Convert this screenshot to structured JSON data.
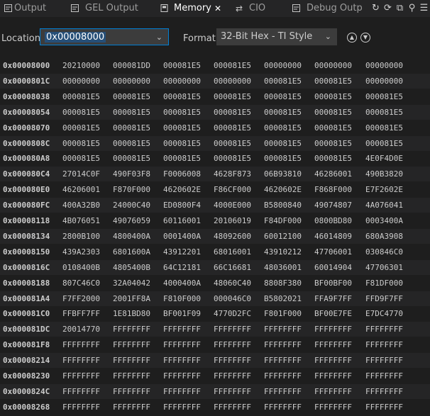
{
  "tabs": [
    {
      "label": "Output",
      "icon": "output-icon",
      "active": false
    },
    {
      "label": "GEL Output",
      "icon": "gel-output-icon",
      "active": false
    },
    {
      "label": "Memory",
      "icon": "memory-icon",
      "active": true
    },
    {
      "label": "CIO",
      "icon": "cio-icon",
      "active": false
    },
    {
      "label": "Debug Outp",
      "icon": "debug-output-icon",
      "active": false
    }
  ],
  "actions": [
    "refresh-icon",
    "sync-icon",
    "copy-icon",
    "pin-icon",
    "menu-icon"
  ],
  "toolbar": {
    "location_label": "Location",
    "location_value": "0x00008000",
    "format_label": "Format",
    "format_value": "32-Bit Hex - TI Style"
  },
  "memory": {
    "rows": [
      [
        "0x00008000",
        "20210000",
        "000081DD",
        "000081E5",
        "000081E5",
        "00000000",
        "00000000",
        "00000000"
      ],
      [
        "0x0000801C",
        "00000000",
        "00000000",
        "00000000",
        "00000000",
        "000081E5",
        "000081E5",
        "00000000"
      ],
      [
        "0x00008038",
        "000081E5",
        "000081E5",
        "000081E5",
        "000081E5",
        "000081E5",
        "000081E5",
        "000081E5"
      ],
      [
        "0x00008054",
        "000081E5",
        "000081E5",
        "000081E5",
        "000081E5",
        "000081E5",
        "000081E5",
        "000081E5"
      ],
      [
        "0x00008070",
        "000081E5",
        "000081E5",
        "000081E5",
        "000081E5",
        "000081E5",
        "000081E5",
        "000081E5"
      ],
      [
        "0x0000808C",
        "000081E5",
        "000081E5",
        "000081E5",
        "000081E5",
        "000081E5",
        "000081E5",
        "000081E5"
      ],
      [
        "0x000080A8",
        "000081E5",
        "000081E5",
        "000081E5",
        "000081E5",
        "000081E5",
        "000081E5",
        "4E0F4D0E"
      ],
      [
        "0x000080C4",
        "27014C0F",
        "490F03F8",
        "F0006008",
        "4628F873",
        "06B93810",
        "46286001",
        "490B3820"
      ],
      [
        "0x000080E0",
        "46206001",
        "F870F000",
        "4620602E",
        "F86CF000",
        "4620602E",
        "F868F000",
        "E7F2602E"
      ],
      [
        "0x000080FC",
        "400A32B0",
        "24000C40",
        "ED0800F4",
        "4000E000",
        "B5800840",
        "49074807",
        "4A076041"
      ],
      [
        "0x00008118",
        "4B076051",
        "49076059",
        "60116001",
        "20106019",
        "F84DF000",
        "0800BD80",
        "0003400A"
      ],
      [
        "0x00008134",
        "2800B100",
        "4800400A",
        "0001400A",
        "48092600",
        "60012100",
        "46014809",
        "680A3908"
      ],
      [
        "0x00008150",
        "439A2303",
        "6801600A",
        "43912201",
        "68016001",
        "43910212",
        "47706001",
        "030846C0"
      ],
      [
        "0x0000816C",
        "0108400B",
        "4805400B",
        "64C12181",
        "66C16681",
        "48036001",
        "60014904",
        "47706301"
      ],
      [
        "0x00008188",
        "807C46C0",
        "32A04042",
        "4000400A",
        "48060C40",
        "8808F380",
        "BF00BF00",
        "F81DF000"
      ],
      [
        "0x000081A4",
        "F7FF2000",
        "2001FF8A",
        "F810F000",
        "000046C0",
        "B5802021",
        "FFA9F7FF",
        "FFD9F7FF"
      ],
      [
        "0x000081C0",
        "FFBFF7FF",
        "1E81BD80",
        "BF001F09",
        "4770D2FC",
        "F801F000",
        "BF00E7FE",
        "E7DC4770"
      ],
      [
        "0x000081DC",
        "20014770",
        "FFFFFFFF",
        "FFFFFFFF",
        "FFFFFFFF",
        "FFFFFFFF",
        "FFFFFFFF",
        "FFFFFFFF"
      ],
      [
        "0x000081F8",
        "FFFFFFFF",
        "FFFFFFFF",
        "FFFFFFFF",
        "FFFFFFFF",
        "FFFFFFFF",
        "FFFFFFFF",
        "FFFFFFFF"
      ],
      [
        "0x00008214",
        "FFFFFFFF",
        "FFFFFFFF",
        "FFFFFFFF",
        "FFFFFFFF",
        "FFFFFFFF",
        "FFFFFFFF",
        "FFFFFFFF"
      ],
      [
        "0x00008230",
        "FFFFFFFF",
        "FFFFFFFF",
        "FFFFFFFF",
        "FFFFFFFF",
        "FFFFFFFF",
        "FFFFFFFF",
        "FFFFFFFF"
      ],
      [
        "0x0000824C",
        "FFFFFFFF",
        "FFFFFFFF",
        "FFFFFFFF",
        "FFFFFFFF",
        "FFFFFFFF",
        "FFFFFFFF",
        "FFFFFFFF"
      ],
      [
        "0x00008268",
        "FFFFFFFF",
        "FFFFFFFF",
        "FFFFFFFF",
        "FFFFFFFF",
        "FFFFFFFF",
        "FFFFFFFF",
        "FFFFFFFF"
      ]
    ]
  },
  "colors": {
    "accent": "#007fd4",
    "selection": "#264f78",
    "background": "#1e1e1e",
    "panel": "#252526"
  }
}
